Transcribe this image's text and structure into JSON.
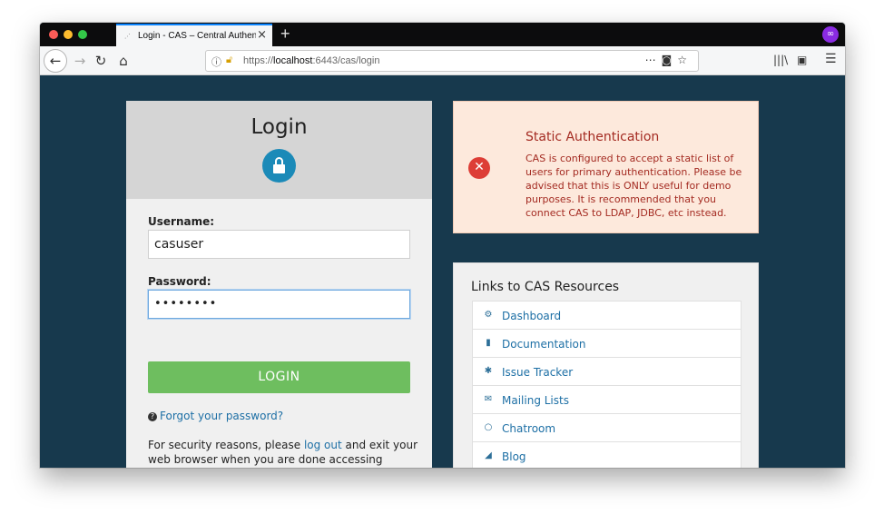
{
  "browser": {
    "tab_title": "Login - CAS – Central Authentic",
    "tab_close": "×",
    "new_tab": "+",
    "url_scheme": "https://",
    "url_host": "localhost",
    "url_rest": ":6443/cas/login"
  },
  "login": {
    "title": "Login",
    "username_label": "Username:",
    "username_value": "casuser",
    "password_label": "Password:",
    "password_value": "••••••••",
    "button_label": "LOGIN",
    "forgot_label": "Forgot your password?",
    "security_prefix": "For security reasons, please",
    "security_link": "log out",
    "security_suffix": "and exit your web browser when you are done accessing services"
  },
  "alert": {
    "title": "Static Authentication",
    "text": "CAS is configured to accept a static list of users for primary authentication. Please be advised that this is ONLY useful for demo purposes. It is recommended that you connect CAS to LDAP, JDBC, etc instead."
  },
  "resources": {
    "title": "Links to CAS Resources",
    "items": [
      {
        "label": "Dashboard",
        "icon": "gears-icon",
        "glyph": "⚙"
      },
      {
        "label": "Documentation",
        "icon": "file-icon",
        "glyph": "▮"
      },
      {
        "label": "Issue Tracker",
        "icon": "bug-icon",
        "glyph": "✱"
      },
      {
        "label": "Mailing Lists",
        "icon": "envelope-icon",
        "glyph": "✉"
      },
      {
        "label": "Chatroom",
        "icon": "chat-icon",
        "glyph": "○"
      },
      {
        "label": "Blog",
        "icon": "rss-icon",
        "glyph": "◢"
      }
    ]
  }
}
